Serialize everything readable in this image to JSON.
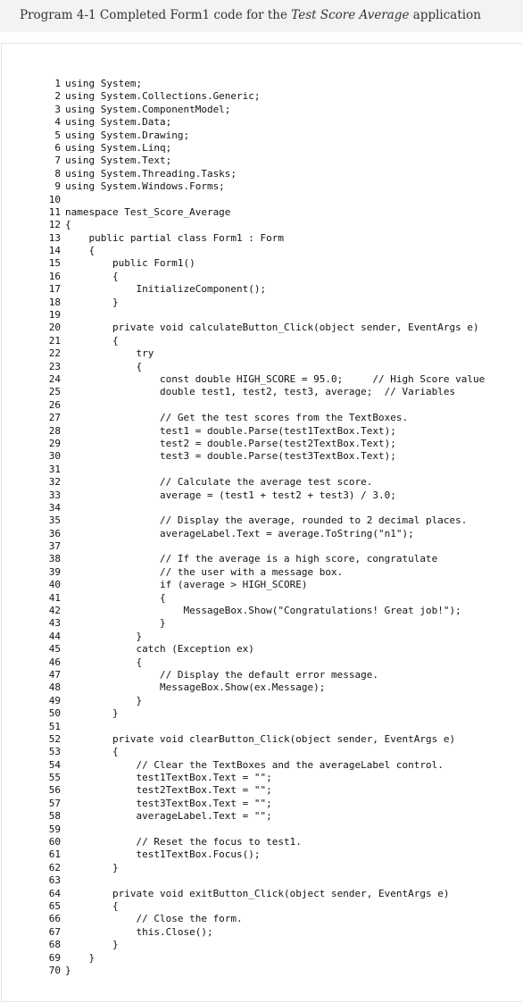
{
  "caption": {
    "prefix": "Program 4-1  Completed Form1 code for the ",
    "italic": "Test Score Average",
    "suffix": " application"
  },
  "code_lines": [
    {
      "n": "1",
      "t": "using System;"
    },
    {
      "n": "2",
      "t": "using System.Collections.Generic;"
    },
    {
      "n": "3",
      "t": "using System.ComponentModel;"
    },
    {
      "n": "4",
      "t": "using System.Data;"
    },
    {
      "n": "5",
      "t": "using System.Drawing;"
    },
    {
      "n": "6",
      "t": "using System.Linq;"
    },
    {
      "n": "7",
      "t": "using System.Text;"
    },
    {
      "n": "8",
      "t": "using System.Threading.Tasks;"
    },
    {
      "n": "9",
      "t": "using System.Windows.Forms;"
    },
    {
      "n": "10",
      "t": ""
    },
    {
      "n": "11",
      "t": "namespace Test_Score_Average"
    },
    {
      "n": "12",
      "t": "{"
    },
    {
      "n": "13",
      "t": "    public partial class Form1 : Form"
    },
    {
      "n": "14",
      "t": "    {"
    },
    {
      "n": "15",
      "t": "        public Form1()"
    },
    {
      "n": "16",
      "t": "        {"
    },
    {
      "n": "17",
      "t": "            InitializeComponent();"
    },
    {
      "n": "18",
      "t": "        }"
    },
    {
      "n": "19",
      "t": ""
    },
    {
      "n": "20",
      "t": "        private void calculateButton_Click(object sender, EventArgs e)"
    },
    {
      "n": "21",
      "t": "        {"
    },
    {
      "n": "22",
      "t": "            try"
    },
    {
      "n": "23",
      "t": "            {"
    },
    {
      "n": "24",
      "t": "                const double HIGH_SCORE = 95.0;     // High Score value"
    },
    {
      "n": "25",
      "t": "                double test1, test2, test3, average;  // Variables"
    },
    {
      "n": "26",
      "t": ""
    },
    {
      "n": "27",
      "t": "                // Get the test scores from the TextBoxes."
    },
    {
      "n": "28",
      "t": "                test1 = double.Parse(test1TextBox.Text);"
    },
    {
      "n": "29",
      "t": "                test2 = double.Parse(test2TextBox.Text);"
    },
    {
      "n": "30",
      "t": "                test3 = double.Parse(test3TextBox.Text);"
    },
    {
      "n": "31",
      "t": ""
    },
    {
      "n": "32",
      "t": "                // Calculate the average test score."
    },
    {
      "n": "33",
      "t": "                average = (test1 + test2 + test3) / 3.0;"
    },
    {
      "n": "34",
      "t": ""
    },
    {
      "n": "35",
      "t": "                // Display the average, rounded to 2 decimal places."
    },
    {
      "n": "36",
      "t": "                averageLabel.Text = average.ToString(\"n1\");"
    },
    {
      "n": "37",
      "t": ""
    },
    {
      "n": "38",
      "t": "                // If the average is a high score, congratulate"
    },
    {
      "n": "39",
      "t": "                // the user with a message box."
    },
    {
      "n": "40",
      "t": "                if (average > HIGH_SCORE)"
    },
    {
      "n": "41",
      "t": "                {"
    },
    {
      "n": "42",
      "t": "                    MessageBox.Show(\"Congratulations! Great job!\");"
    },
    {
      "n": "43",
      "t": "                }"
    },
    {
      "n": "44",
      "t": "            }"
    },
    {
      "n": "45",
      "t": "            catch (Exception ex)"
    },
    {
      "n": "46",
      "t": "            {"
    },
    {
      "n": "47",
      "t": "                // Display the default error message."
    },
    {
      "n": "48",
      "t": "                MessageBox.Show(ex.Message);"
    },
    {
      "n": "49",
      "t": "            }"
    },
    {
      "n": "50",
      "t": "        }"
    },
    {
      "n": "51",
      "t": ""
    },
    {
      "n": "52",
      "t": "        private void clearButton_Click(object sender, EventArgs e)"
    },
    {
      "n": "53",
      "t": "        {"
    },
    {
      "n": "54",
      "t": "            // Clear the TextBoxes and the averageLabel control."
    },
    {
      "n": "55",
      "t": "            test1TextBox.Text = \"\";"
    },
    {
      "n": "56",
      "t": "            test2TextBox.Text = \"\";"
    },
    {
      "n": "57",
      "t": "            test3TextBox.Text = \"\";"
    },
    {
      "n": "58",
      "t": "            averageLabel.Text = \"\";"
    },
    {
      "n": "59",
      "t": ""
    },
    {
      "n": "60",
      "t": "            // Reset the focus to test1."
    },
    {
      "n": "61",
      "t": "            test1TextBox.Focus();"
    },
    {
      "n": "62",
      "t": "        }"
    },
    {
      "n": "63",
      "t": ""
    },
    {
      "n": "64",
      "t": "        private void exitButton_Click(object sender, EventArgs e)"
    },
    {
      "n": "65",
      "t": "        {"
    },
    {
      "n": "66",
      "t": "            // Close the form."
    },
    {
      "n": "67",
      "t": "            this.Close();"
    },
    {
      "n": "68",
      "t": "        }"
    },
    {
      "n": "69",
      "t": "    }"
    },
    {
      "n": "70",
      "t": "}"
    }
  ]
}
